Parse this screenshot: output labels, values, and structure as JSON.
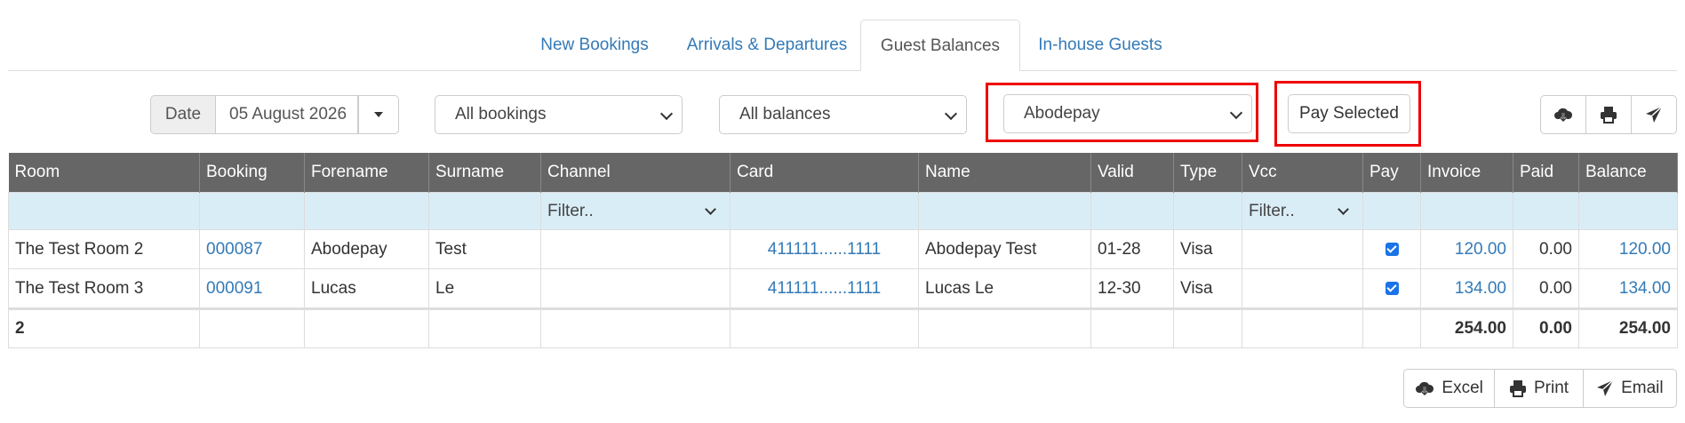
{
  "tabs": [
    {
      "label": "New Bookings"
    },
    {
      "label": "Arrivals & Departures"
    },
    {
      "label": "Guest Balances"
    },
    {
      "label": "In-house Guests"
    }
  ],
  "controls": {
    "date_label": "Date",
    "date_value": "05 August 2026",
    "bookings_select": "All bookings",
    "balances_select": "All balances",
    "gateway_select": "Abodepay",
    "pay_selected": "Pay Selected",
    "highlight_color": "#ee0000"
  },
  "table": {
    "headers": [
      "Room",
      "Booking",
      "Forename",
      "Surname",
      "Channel",
      "Card",
      "Name",
      "Valid",
      "Type",
      "Vcc",
      "Pay",
      "Invoice",
      "Paid",
      "Balance"
    ],
    "filter_placeholder": "Filter..",
    "rows": [
      {
        "room": "The Test Room 2",
        "booking": "000087",
        "forename": "Abodepay",
        "surname": "Test",
        "channel": "",
        "card": "411111......1111",
        "name": "Abodepay Test",
        "valid": "01-28",
        "type": "Visa",
        "vcc": "",
        "pay": true,
        "invoice": "120.00",
        "paid": "0.00",
        "balance": "120.00"
      },
      {
        "room": "The Test Room 3",
        "booking": "000091",
        "forename": "Lucas",
        "surname": "Le",
        "channel": "",
        "card": "411111......1111",
        "name": "Lucas Le",
        "valid": "12-30",
        "type": "Visa",
        "vcc": "",
        "pay": true,
        "invoice": "134.00",
        "paid": "0.00",
        "balance": "134.00"
      }
    ],
    "totals": {
      "count": "2",
      "invoice": "254.00",
      "paid": "0.00",
      "balance": "254.00"
    }
  },
  "export": {
    "excel": "Excel",
    "print": "Print",
    "email": "Email",
    "icons": [
      "cloud-download-icon",
      "printer-icon",
      "send-icon"
    ]
  }
}
